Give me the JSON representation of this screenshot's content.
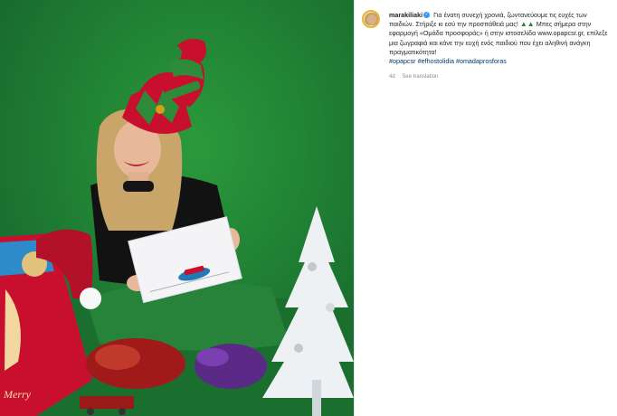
{
  "post": {
    "username": "marakiliaki",
    "caption_line_1": "Για ένατη συνεχή χρονιά, ζωντανεύουμε τις ευχές των παιδιών. Στήριξε κι εσύ την προσπάθειά μας!",
    "caption_line_2": "Μπες σήμερα στην εφαρμογή «Ομάδα προσφοράς» ή στην ιστοσελίδα www.opapcsr.gr, επίλεξε μια ζωγραφιά και κάνε την ευχή ενός παιδιού που έχει αληθινή ανάγκη πραγματικότητα!",
    "hashtags": [
      "#opapcsr",
      "#efhostolidia",
      "#omadaprosforas"
    ],
    "time_ago": "4d",
    "see_translation": "See translation"
  },
  "icons": {
    "verified": "verified-badge-icon",
    "tree_emoji": "christmas-tree-icon"
  },
  "colors": {
    "backdrop_green": "#1f7a2e",
    "hat_red": "#c8102e",
    "hat_green": "#2e8b3a",
    "link_blue": "#00376b",
    "verified_blue": "#3897f0"
  }
}
